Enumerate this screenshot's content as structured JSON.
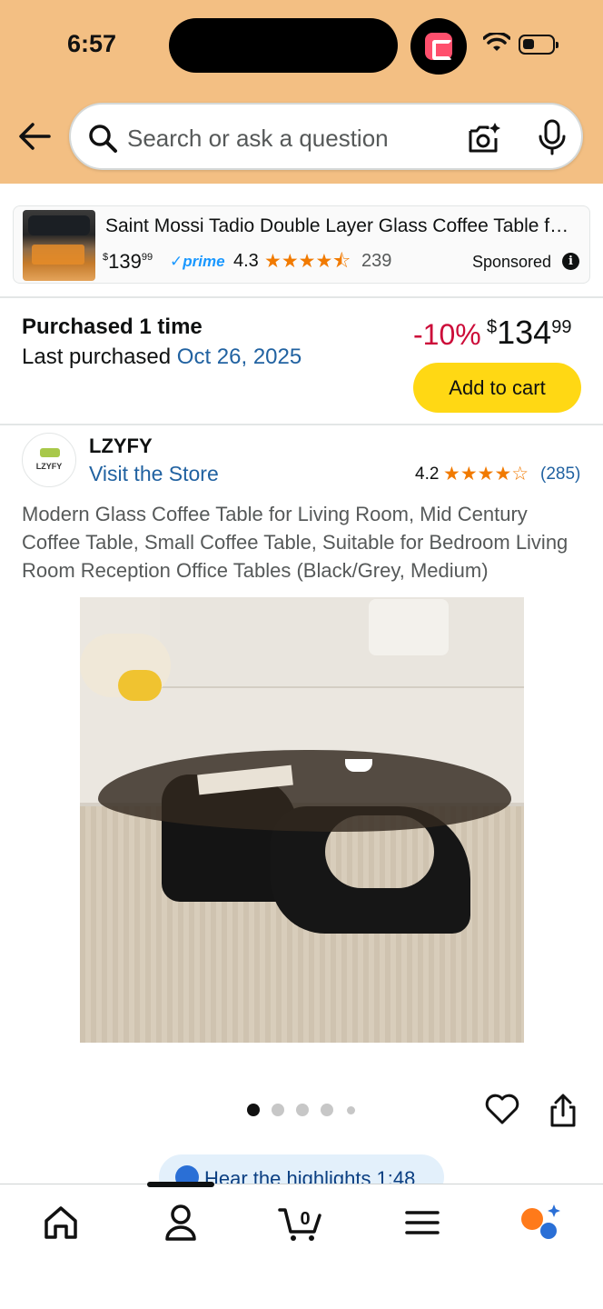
{
  "status_bar": {
    "time": "6:57"
  },
  "search": {
    "placeholder": "Search or ask a question"
  },
  "ad": {
    "title": "Saint Mossi Tadio Double Layer Glass Coffee Table for...",
    "price_currency": "$",
    "price_whole": "139",
    "price_cents": "99",
    "prime_label": "prime",
    "rating": "4.3",
    "stars": "★★★★⯪",
    "review_count": "239",
    "sponsored_label": "Sponsored"
  },
  "purchase": {
    "title": "Purchased 1 time",
    "last_label": "Last purchased",
    "last_date": "Oct 26, 2025",
    "discount": "-10%",
    "price_currency": "$",
    "price_whole": "134",
    "price_cents": "99",
    "add_to_cart_label": "Add to cart"
  },
  "brand": {
    "logo_text": "LZYFY",
    "name": "LZYFY",
    "visit_store_label": "Visit the Store",
    "rating": "4.2",
    "stars": "★★★★☆",
    "review_count": "(285)"
  },
  "product": {
    "title": "Modern Glass Coffee Table for Living Room, Mid Century Coffee Table, Small Coffee Table, Suitable for Bedroom Living Room Reception Office Tables (Black/Grey, Medium)",
    "image_count": 5,
    "active_image_index": 0
  },
  "highlights": {
    "label": "Hear the highlights 1:48"
  },
  "bottom_nav": {
    "items": [
      "home-icon",
      "account-icon",
      "cart-icon",
      "menu-icon",
      "rufus-ai-icon"
    ],
    "cart_count": "0"
  },
  "colors": {
    "header_bg": "#f3bf83",
    "add_to_cart_bg": "#ffd814",
    "link_blue": "#2162a1",
    "discount_red": "#cc0c39",
    "star_orange": "#f17a00"
  }
}
